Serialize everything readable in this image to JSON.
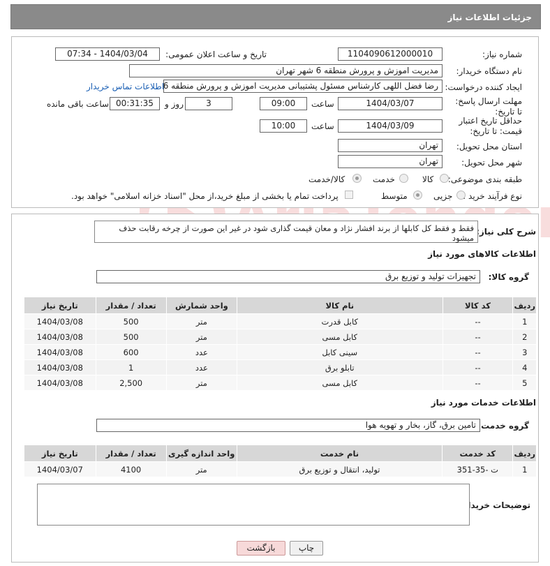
{
  "header": {
    "title": "جزئیات اطلاعات نیاز"
  },
  "form": {
    "need_number_label": "شماره نیاز:",
    "need_number": "1104090612000010",
    "announce_label": "تاریخ و ساعت اعلان عمومی:",
    "announce_value": "1404/03/04 - 07:34",
    "buyer_org_label": "نام دستگاه خریدار:",
    "buyer_org": "مدیریت اموزش و پرورش منطقه 6 شهر تهران",
    "creator_label": "ایجاد کننده درخواست:",
    "creator": "رضا فضل اللهی کارشناس مسئول پشتیبانی  مدیریت اموزش و پرورش منطقه 6",
    "contact_link": "اطلاعات تماس خریدار",
    "deadline_label": "مهلت ارسال پاسخ: تا تاریخ:",
    "deadline_date": "1404/03/07",
    "time_label": "ساعت",
    "deadline_time": "09:00",
    "days_value": "3",
    "days_label": "روز و",
    "remaining_time": "00:31:35",
    "remaining_label": "ساعت باقی مانده",
    "min_validity_label": "حداقل تاریخ اعتبار قیمت: تا تاریخ:",
    "validity_date": "1404/03/09",
    "validity_time": "10:00",
    "province_label": "استان محل تحویل:",
    "province": "تهران",
    "city_label": "شهر محل تحویل:",
    "city": "تهران",
    "category_label": "طبقه بندی موضوعی:",
    "category_options": [
      "کالا",
      "خدمت",
      "کالا/خدمت"
    ],
    "purchase_type_label": "نوع فرآیند خرید :",
    "purchase_options": [
      "جزیی",
      "متوسط"
    ],
    "payment_note": "پرداخت تمام یا بخشی از مبلغ خرید،از محل \"اسناد خزانه اسلامی\" خواهد بود."
  },
  "description": {
    "label": "شرح کلی نیاز:",
    "text": "فقط و فقط کل کابلها از برند افشار نژاد و معان قیمت گذاری شود در غیر این صورت از چرخه رقابت حذف میشود"
  },
  "goods": {
    "section_title": "اطلاعات کالاهای مورد نیاز",
    "group_label": "گروه کالا:",
    "group_value": "تجهیزات تولید و توزیع برق",
    "columns": [
      "ردیف",
      "کد کالا",
      "نام کالا",
      "واحد شمارش",
      "تعداد / مقدار",
      "تاریخ نیاز"
    ],
    "rows": [
      [
        "1",
        "--",
        "کابل قدرت",
        "متر",
        "500",
        "1404/03/08"
      ],
      [
        "2",
        "--",
        "کابل مسی",
        "متر",
        "500",
        "1404/03/08"
      ],
      [
        "3",
        "--",
        "سینی کابل",
        "عدد",
        "600",
        "1404/03/08"
      ],
      [
        "4",
        "--",
        "تابلو برق",
        "عدد",
        "1",
        "1404/03/08"
      ],
      [
        "5",
        "--",
        "کابل مسی",
        "متر",
        "2,500",
        "1404/03/08"
      ]
    ]
  },
  "services": {
    "section_title": "اطلاعات خدمات مورد نیاز",
    "group_label": "گروه خدمت:",
    "group_value": "تامین برق، گاز، بخار و تهویه هوا",
    "columns": [
      "ردیف",
      "کد خدمت",
      "نام خدمت",
      "واحد اندازه گیری",
      "تعداد / مقدار",
      "تاریخ نیاز"
    ],
    "rows": [
      [
        "1",
        "ت -35-351",
        "تولید، انتقال و توزیع برق",
        "متر",
        "4100",
        "1404/03/07"
      ]
    ]
  },
  "buyer_notes": {
    "label": "توضیحات خریدار:",
    "text": ""
  },
  "buttons": {
    "print": "چاپ",
    "back": "بازگشت"
  },
  "watermark": {
    "text": "AriaTender.net"
  },
  "colors": {
    "header_bg": "#8a8a8a",
    "link": "#1a5fb4",
    "back_button": "#f7d9d9",
    "table_header": "#d7d7d7"
  }
}
